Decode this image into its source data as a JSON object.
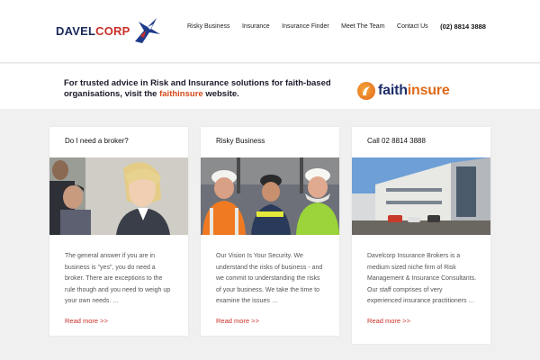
{
  "header": {
    "logo": {
      "part1": "DAVEL",
      "part2": "CORP"
    },
    "nav": [
      {
        "label": "Risky Business"
      },
      {
        "label": "Insurance"
      },
      {
        "label": "Insurance Finder"
      },
      {
        "label": "Meet The Team"
      },
      {
        "label": "Contact Us"
      }
    ],
    "phone": "(02) 8814 3888"
  },
  "banner": {
    "text_before": "For trusted advice in Risk and Insurance solutions for faith-based organisations, visit the",
    "highlight": "faithinsure",
    "text_after": "website.",
    "partner_logo": {
      "part1": "faith",
      "part2": "insure"
    }
  },
  "cards": [
    {
      "title": "Do I need a broker?",
      "body": "The general answer if you are in business is \"yes\", you do need a broker. There are exceptions to the rule though and you need to weigh up your own needs. …",
      "more": "Read more >>"
    },
    {
      "title": "Risky Business",
      "body": "Our Vision Is Your Security. We understand the risks of business - and we commit to understanding the risks of your business. We take the time to examine the issues …",
      "more": "Read more >>"
    },
    {
      "title": "Call 02 8814 3888",
      "body": "Davelcorp Insurance Brokers is a medium sized niche firm of Risk Management & Insurance Consultants. Our staff comprises of very experienced insurance practitioners …",
      "more": "Read more >>"
    }
  ],
  "colors": {
    "accent": "#c8302a",
    "brand_navy": "#1a2a5a",
    "highlight": "#d24a1a",
    "background": "#f0f0f0"
  }
}
